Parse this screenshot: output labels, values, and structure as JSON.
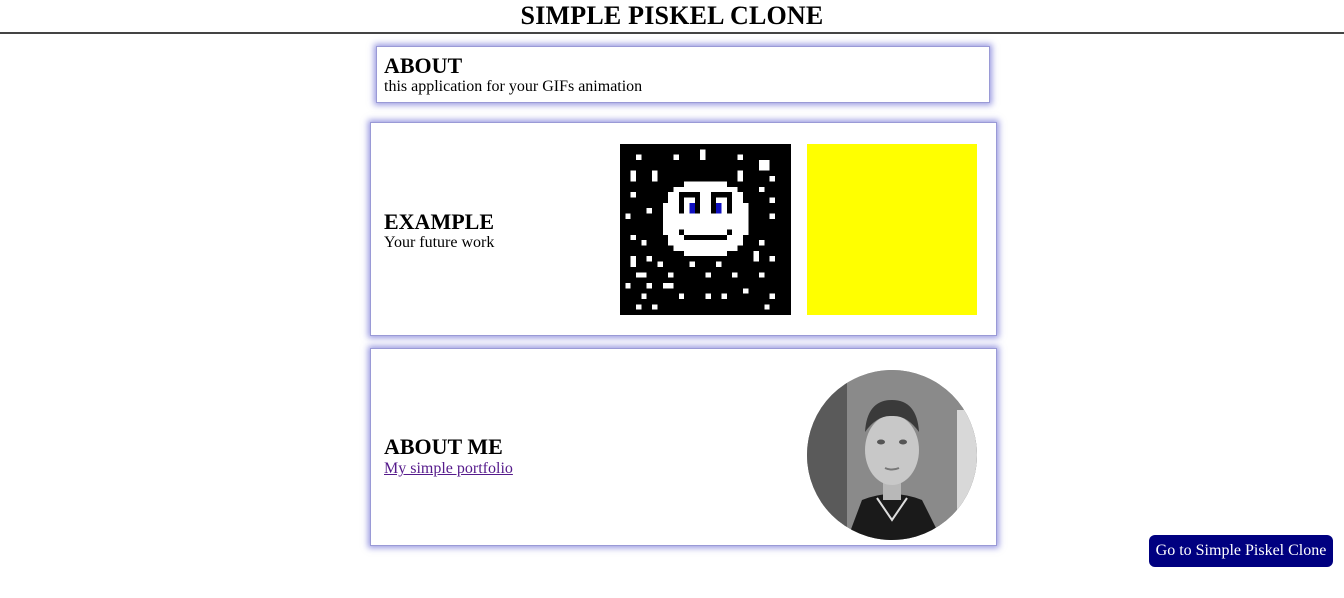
{
  "header": {
    "title": "SIMPLE PISKEL CLONE"
  },
  "about": {
    "heading": "ABOUT",
    "text": "this application for your GIFs animation"
  },
  "example": {
    "heading": "EXAMPLE",
    "text": "Your future work",
    "preview_color": "#ffff00"
  },
  "about_me": {
    "heading": "ABOUT ME",
    "link_text": "My simple portfolio"
  },
  "goto_button": {
    "label": "Go to Simple Piskel Clone"
  },
  "colors": {
    "accent": "#000080",
    "card_shadow": "#4646c8",
    "link": "#551a8b"
  }
}
